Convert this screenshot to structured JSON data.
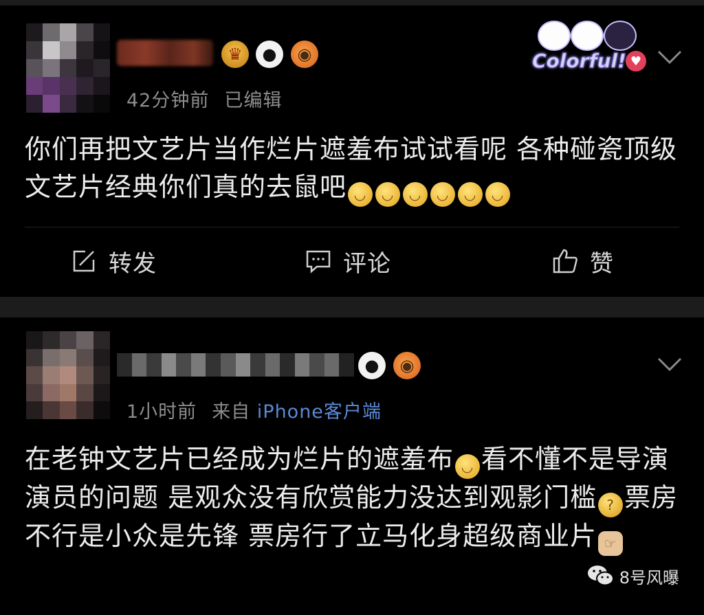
{
  "post1": {
    "time": "42分钟前",
    "edited": "已编辑",
    "content_text": "你们再把文艺片当作烂片遮羞布试试看呢  各种碰瓷顶级文艺片经典你们真的去鼠吧",
    "emoji_count": 6,
    "sticker_text": "Colorful!",
    "actions": {
      "repost": "转发",
      "comment": "评论",
      "like": "赞"
    }
  },
  "post2": {
    "time": "1小时前",
    "source_prefix": "来自",
    "source": "iPhone客户端",
    "content_parts": [
      "在老钟文艺片已经成为烂片的遮羞布",
      "看不懂不是导演演员的问题 是观众没有欣赏能力没达到观影门槛",
      "票房不行是小众是先锋 票房行了立马化身超级商业片"
    ]
  },
  "watermark": "8号风曝",
  "colors": {
    "background": "#000000",
    "divider": "#1c1c1c",
    "meta_text": "#8d8d8d",
    "source_link": "#5a8ad6"
  },
  "icons": {
    "badges_post1": [
      "crown-badge-icon",
      "panda-badge-icon",
      "fish-badge-icon"
    ],
    "badges_post2": [
      "panda-badge-icon",
      "fish-badge-icon"
    ],
    "actions": [
      "share-icon",
      "comment-icon",
      "thumbs-up-icon"
    ],
    "menu": "chevron-down-icon",
    "watermark": "wechat-icon"
  }
}
